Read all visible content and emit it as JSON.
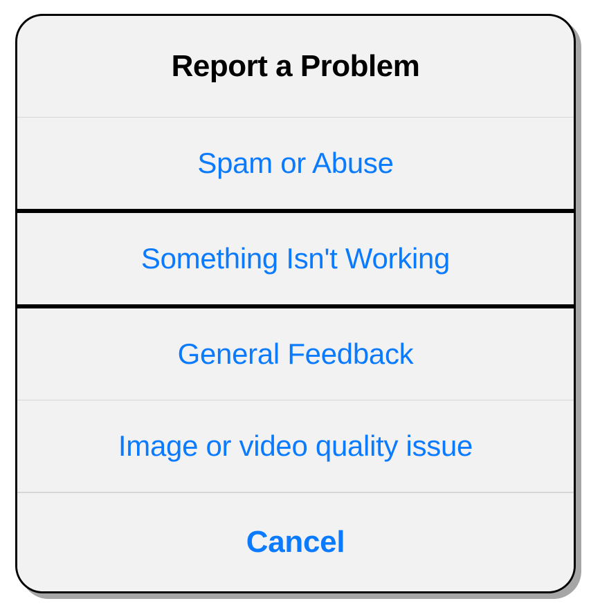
{
  "sheet": {
    "title": "Report a Problem",
    "options": [
      {
        "label": "Spam or Abuse",
        "highlighted": false
      },
      {
        "label": "Something Isn't Working",
        "highlighted": true
      },
      {
        "label": "General Feedback",
        "highlighted": false
      },
      {
        "label": "Image or video quality issue",
        "highlighted": false
      }
    ],
    "cancel_label": "Cancel"
  }
}
